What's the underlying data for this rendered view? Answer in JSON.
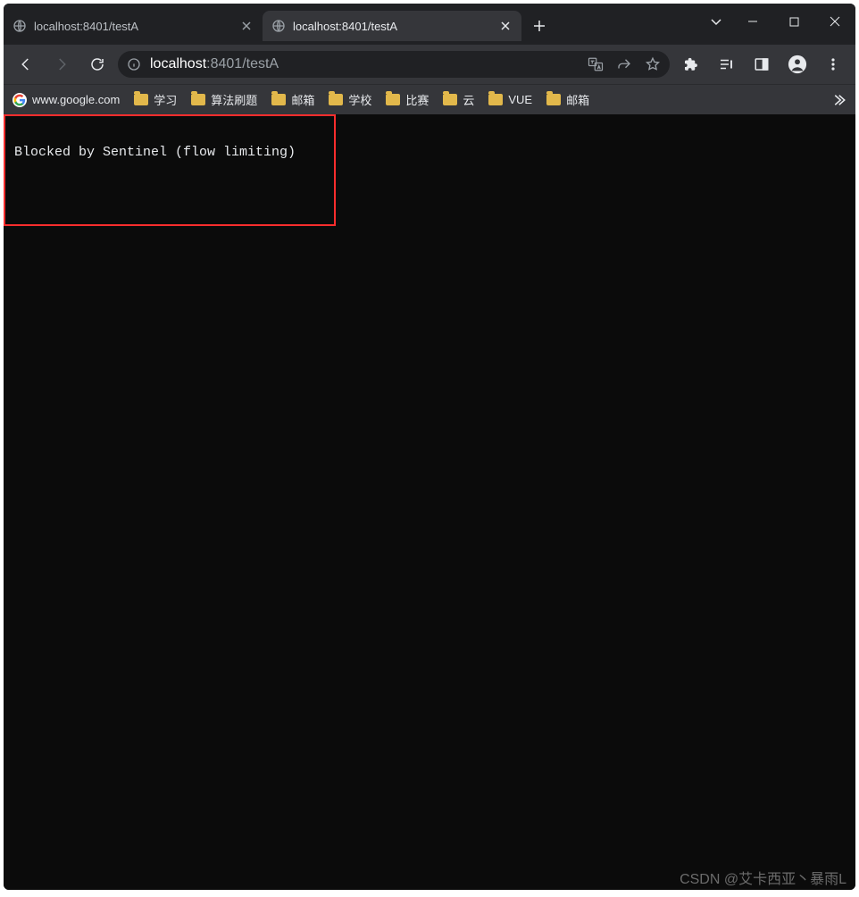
{
  "tabs": [
    {
      "title": "localhost:8401/testA",
      "active": false
    },
    {
      "title": "localhost:8401/testA",
      "active": true
    }
  ],
  "omnibox": {
    "host": "localhost",
    "rest": ":8401/testA"
  },
  "bookmarks": [
    {
      "label": "www.google.com",
      "icon": "google"
    },
    {
      "label": "学习",
      "icon": "folder"
    },
    {
      "label": "算法刷题",
      "icon": "folder"
    },
    {
      "label": "邮箱",
      "icon": "folder"
    },
    {
      "label": "学校",
      "icon": "folder"
    },
    {
      "label": "比赛",
      "icon": "folder"
    },
    {
      "label": "云",
      "icon": "folder"
    },
    {
      "label": "VUE",
      "icon": "folder"
    },
    {
      "label": "邮箱",
      "icon": "folder"
    }
  ],
  "page": {
    "body_text": "Blocked by Sentinel (flow limiting)"
  },
  "watermark": "CSDN @艾卡西亚丶暴雨L"
}
